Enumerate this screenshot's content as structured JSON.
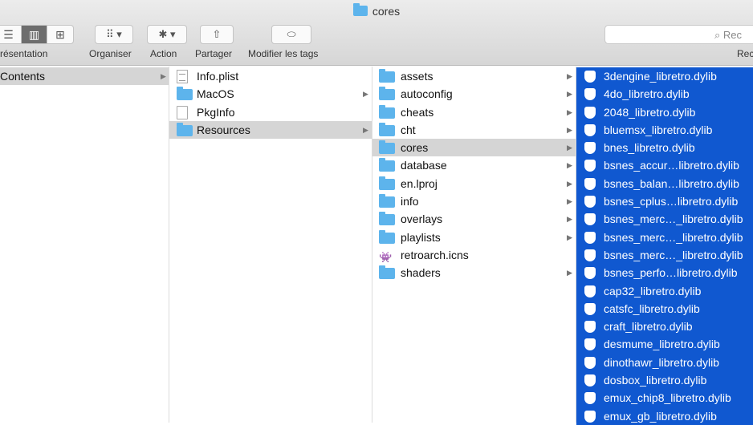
{
  "window": {
    "title": "cores"
  },
  "toolbar": {
    "view_label": "résentation",
    "arrange_label": "Organiser",
    "action_label": "Action",
    "share_label": "Partager",
    "tags_label": "Modifier les tags",
    "search_placeholder": "Rec",
    "search_label": "Rec",
    "view_glyphs": [
      "☰",
      "▥",
      "⊞"
    ],
    "arrange_glyph": "⠿ ▾",
    "action_glyph": "✱ ▾",
    "share_glyph": "⇧",
    "tag_glyph": "⬭"
  },
  "col1": {
    "items": [
      {
        "label": "Contents",
        "has_children": true,
        "state": "highlighted"
      }
    ]
  },
  "col2": {
    "items": [
      {
        "label": "Info.plist",
        "icon": "plist-icon",
        "has_children": false
      },
      {
        "label": "MacOS",
        "icon": "folder-icon",
        "has_children": true
      },
      {
        "label": "PkgInfo",
        "icon": "document-icon",
        "has_children": false
      },
      {
        "label": "Resources",
        "icon": "folder-icon",
        "has_children": true,
        "state": "highlighted"
      }
    ]
  },
  "col3": {
    "items": [
      {
        "label": "assets",
        "icon": "folder-icon",
        "has_children": true
      },
      {
        "label": "autoconfig",
        "icon": "folder-icon",
        "has_children": true
      },
      {
        "label": "cheats",
        "icon": "folder-icon",
        "has_children": true
      },
      {
        "label": "cht",
        "icon": "folder-icon",
        "has_children": true
      },
      {
        "label": "cores",
        "icon": "folder-icon",
        "has_children": true,
        "state": "highlighted"
      },
      {
        "label": "database",
        "icon": "folder-icon",
        "has_children": true
      },
      {
        "label": "en.lproj",
        "icon": "folder-icon",
        "has_children": true
      },
      {
        "label": "info",
        "icon": "folder-icon",
        "has_children": true
      },
      {
        "label": "overlays",
        "icon": "folder-icon",
        "has_children": true
      },
      {
        "label": "playlists",
        "icon": "folder-icon",
        "has_children": true
      },
      {
        "label": "retroarch.icns",
        "icon": "icns-icon",
        "has_children": false
      },
      {
        "label": "shaders",
        "icon": "folder-icon",
        "has_children": true
      }
    ]
  },
  "col4": {
    "items": [
      {
        "label": "3dengine_libretro.dylib",
        "has_children": true
      },
      {
        "label": "4do_libretro.dylib",
        "has_children": true
      },
      {
        "label": "2048_libretro.dylib",
        "has_children": true
      },
      {
        "label": "bluemsx_libretro.dylib",
        "has_children": true
      },
      {
        "label": "bnes_libretro.dylib",
        "has_children": true
      },
      {
        "label": "bsnes_accur…libretro.dylib",
        "has_children": true
      },
      {
        "label": "bsnes_balan…libretro.dylib",
        "has_children": true
      },
      {
        "label": "bsnes_cplus…libretro.dylib",
        "has_children": true
      },
      {
        "label": "bsnes_merc…_libretro.dylib",
        "has_children": true
      },
      {
        "label": "bsnes_merc…_libretro.dylib",
        "has_children": true
      },
      {
        "label": "bsnes_merc…_libretro.dylib",
        "has_children": false
      },
      {
        "label": "bsnes_perfo…libretro.dylib",
        "has_children": true
      },
      {
        "label": "cap32_libretro.dylib",
        "has_children": false
      },
      {
        "label": "catsfc_libretro.dylib",
        "has_children": false
      },
      {
        "label": "craft_libretro.dylib",
        "has_children": false
      },
      {
        "label": "desmume_libretro.dylib",
        "has_children": false
      },
      {
        "label": "dinothawr_libretro.dylib",
        "has_children": false
      },
      {
        "label": "dosbox_libretro.dylib",
        "has_children": false
      },
      {
        "label": "emux_chip8_libretro.dylib",
        "has_children": false
      },
      {
        "label": "emux_gb_libretro.dylib",
        "has_children": false
      }
    ]
  },
  "colors": {
    "selection": "#1058d0",
    "highlight": "#d5d5d5",
    "folder": "#5db4ec"
  }
}
